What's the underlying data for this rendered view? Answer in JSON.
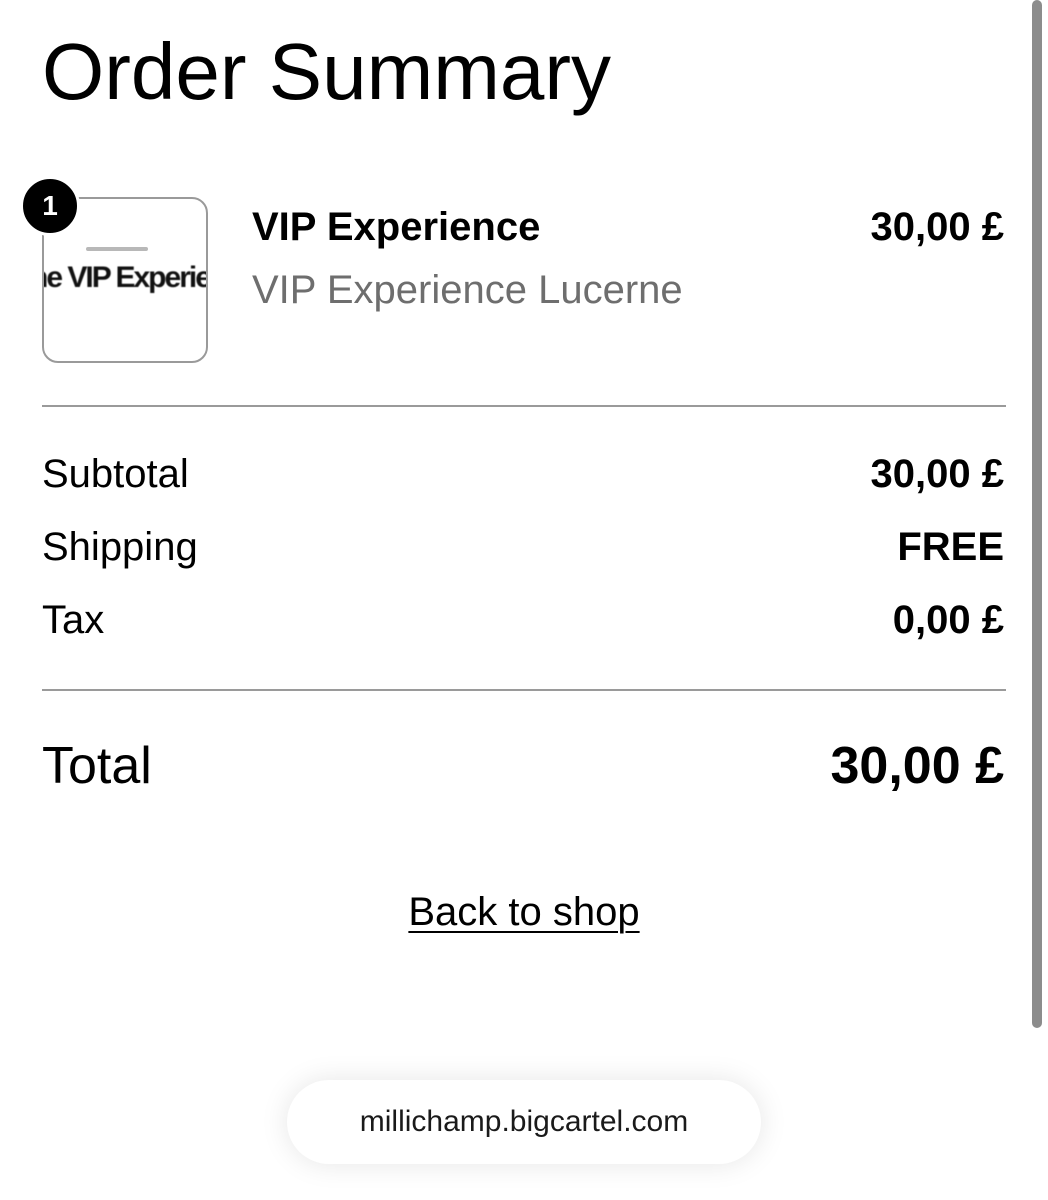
{
  "page": {
    "title": "Order Summary"
  },
  "item": {
    "quantity": "1",
    "name": "VIP Experience",
    "variant": "VIP Experience Lucerne",
    "price": "30,00 £",
    "thumbnail_text": "he VIP Experience"
  },
  "summary": {
    "subtotal_label": "Subtotal",
    "subtotal_value": "30,00 £",
    "shipping_label": "Shipping",
    "shipping_value": "FREE",
    "tax_label": "Tax",
    "tax_value": "0,00 £",
    "total_label": "Total",
    "total_value": "30,00 £"
  },
  "actions": {
    "back_label": "Back to shop"
  },
  "browser": {
    "url": "millichamp.bigcartel.com"
  },
  "colors": {
    "text": "#000000",
    "muted": "#6e6e6e",
    "divider": "#9a9a9a",
    "badge": "#000000"
  }
}
